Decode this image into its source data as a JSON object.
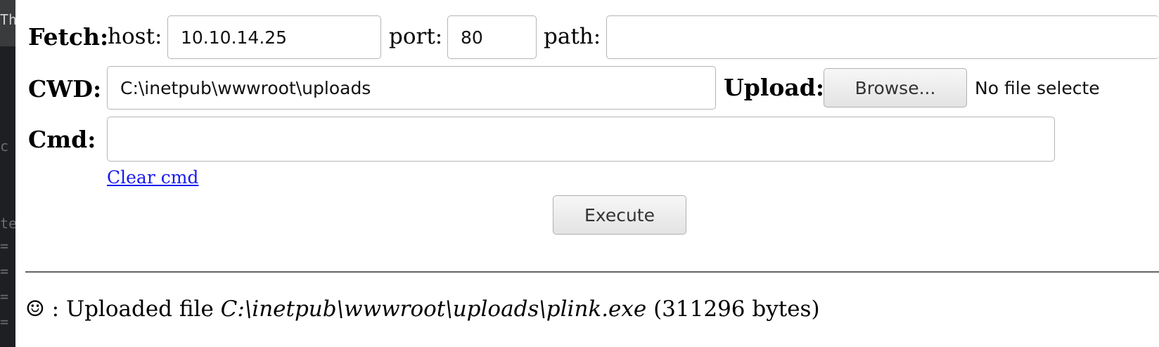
{
  "fetch": {
    "label": "Fetch:",
    "host_label": "host:",
    "host_value": "10.10.14.25",
    "port_label": "port:",
    "port_value": "80",
    "path_label": "path:",
    "path_value": ""
  },
  "cwd": {
    "label": "CWD:",
    "value": "C:\\inetpub\\wwwroot\\uploads"
  },
  "upload": {
    "label": "Upload:",
    "browse_label": "Browse...",
    "file_status": "No file selecte"
  },
  "cmd": {
    "label": "Cmd:",
    "value": "",
    "clear_link": "Clear cmd",
    "execute_label": "Execute"
  },
  "status": {
    "icon": "☺",
    "prefix": " : Uploaded file ",
    "path": "C:\\inetpub\\wwwroot\\uploads\\plink.exe",
    "suffix": " (311296 bytes)"
  },
  "background": {
    "terminal_chars": [
      "Th",
      "c",
      "te",
      "= ",
      "= ",
      "= ",
      "= "
    ]
  },
  "colors": {
    "link": "#1a1aee",
    "terminal_bg": "#1e1f22"
  }
}
